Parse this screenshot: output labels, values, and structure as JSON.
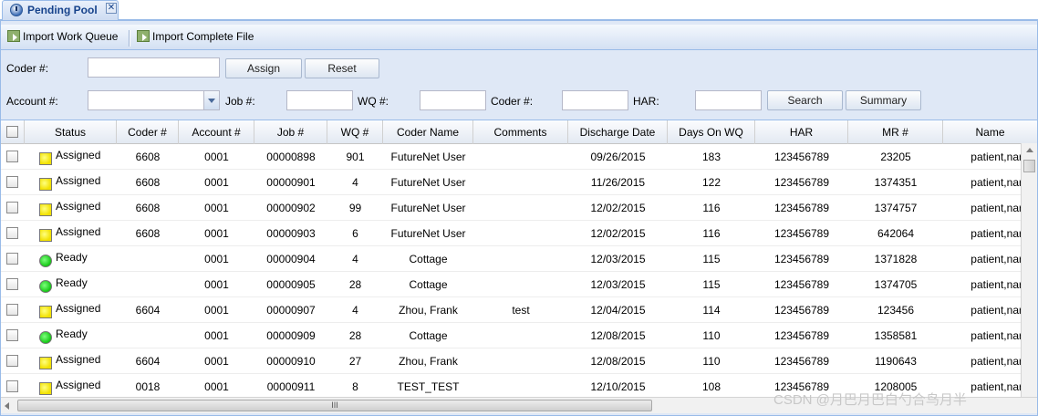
{
  "tab": {
    "title": "Pending Pool",
    "close_glyph": "✕",
    "icon": "clock-icon"
  },
  "toolbar": {
    "import_work_queue": "Import Work Queue",
    "import_complete_file": "Import Complete File",
    "import_icon": "import-icon"
  },
  "assign_form": {
    "coder_label": "Coder #:",
    "coder_value": "",
    "assign_button": "Assign",
    "reset_button": "Reset"
  },
  "search_form": {
    "account_label": "Account #:",
    "account_value": "",
    "job_label": "Job #:",
    "job_value": "",
    "wq_label": "WQ #:",
    "wq_value": "",
    "coder_label": "Coder #:",
    "coder_value": "",
    "har_label": "HAR:",
    "har_value": "",
    "search_button": "Search",
    "summary_button": "Summary"
  },
  "grid": {
    "columns": [
      "Status",
      "Coder #",
      "Account #",
      "Job #",
      "WQ #",
      "Coder Name",
      "Comments",
      "Discharge Date",
      "Days On WQ",
      "HAR",
      "MR #",
      "Name"
    ],
    "rows": [
      {
        "status": "Assigned",
        "status_color": "yellow",
        "coder": "6608",
        "account": "0001",
        "job": "00000898",
        "wq": "901",
        "coder_name": "FutureNet User",
        "comments": "",
        "discharge_date": "09/26/2015",
        "days_on_wq": "183",
        "har": "123456789",
        "mr": "23205",
        "name": "patient,nar"
      },
      {
        "status": "Assigned",
        "status_color": "yellow",
        "coder": "6608",
        "account": "0001",
        "job": "00000901",
        "wq": "4",
        "coder_name": "FutureNet User",
        "comments": "",
        "discharge_date": "11/26/2015",
        "days_on_wq": "122",
        "har": "123456789",
        "mr": "1374351",
        "name": "patient,nar"
      },
      {
        "status": "Assigned",
        "status_color": "yellow",
        "coder": "6608",
        "account": "0001",
        "job": "00000902",
        "wq": "99",
        "coder_name": "FutureNet User",
        "comments": "",
        "discharge_date": "12/02/2015",
        "days_on_wq": "116",
        "har": "123456789",
        "mr": "1374757",
        "name": "patient,nar"
      },
      {
        "status": "Assigned",
        "status_color": "yellow",
        "coder": "6608",
        "account": "0001",
        "job": "00000903",
        "wq": "6",
        "coder_name": "FutureNet User",
        "comments": "",
        "discharge_date": "12/02/2015",
        "days_on_wq": "116",
        "har": "123456789",
        "mr": "642064",
        "name": "patient,nar"
      },
      {
        "status": "Ready",
        "status_color": "green",
        "coder": "",
        "account": "0001",
        "job": "00000904",
        "wq": "4",
        "coder_name": "Cottage",
        "comments": "",
        "discharge_date": "12/03/2015",
        "days_on_wq": "115",
        "har": "123456789",
        "mr": "1371828",
        "name": "patient,nar"
      },
      {
        "status": "Ready",
        "status_color": "green",
        "coder": "",
        "account": "0001",
        "job": "00000905",
        "wq": "28",
        "coder_name": "Cottage",
        "comments": "",
        "discharge_date": "12/03/2015",
        "days_on_wq": "115",
        "har": "123456789",
        "mr": "1374705",
        "name": "patient,nar"
      },
      {
        "status": "Assigned",
        "status_color": "yellow",
        "coder": "6604",
        "account": "0001",
        "job": "00000907",
        "wq": "4",
        "coder_name": "Zhou, Frank",
        "comments": "test",
        "discharge_date": "12/04/2015",
        "days_on_wq": "114",
        "har": "123456789",
        "mr": "123456",
        "name": "patient,nar"
      },
      {
        "status": "Ready",
        "status_color": "green",
        "coder": "",
        "account": "0001",
        "job": "00000909",
        "wq": "28",
        "coder_name": "Cottage",
        "comments": "",
        "discharge_date": "12/08/2015",
        "days_on_wq": "110",
        "har": "123456789",
        "mr": "1358581",
        "name": "patient,nar"
      },
      {
        "status": "Assigned",
        "status_color": "yellow",
        "coder": "6604",
        "account": "0001",
        "job": "00000910",
        "wq": "27",
        "coder_name": "Zhou, Frank",
        "comments": "",
        "discharge_date": "12/08/2015",
        "days_on_wq": "110",
        "har": "123456789",
        "mr": "1190643",
        "name": "patient,nar"
      },
      {
        "status": "Assigned",
        "status_color": "yellow",
        "coder": "0018",
        "account": "0001",
        "job": "00000911",
        "wq": "8",
        "coder_name": "TEST_TEST",
        "comments": "",
        "discharge_date": "12/10/2015",
        "days_on_wq": "108",
        "har": "123456789",
        "mr": "1208005",
        "name": "patient,nar"
      }
    ]
  },
  "scrollbar": {
    "thumb_grip": "III"
  },
  "watermark": "CSDN @月巴月巴白勺合鸟月半"
}
